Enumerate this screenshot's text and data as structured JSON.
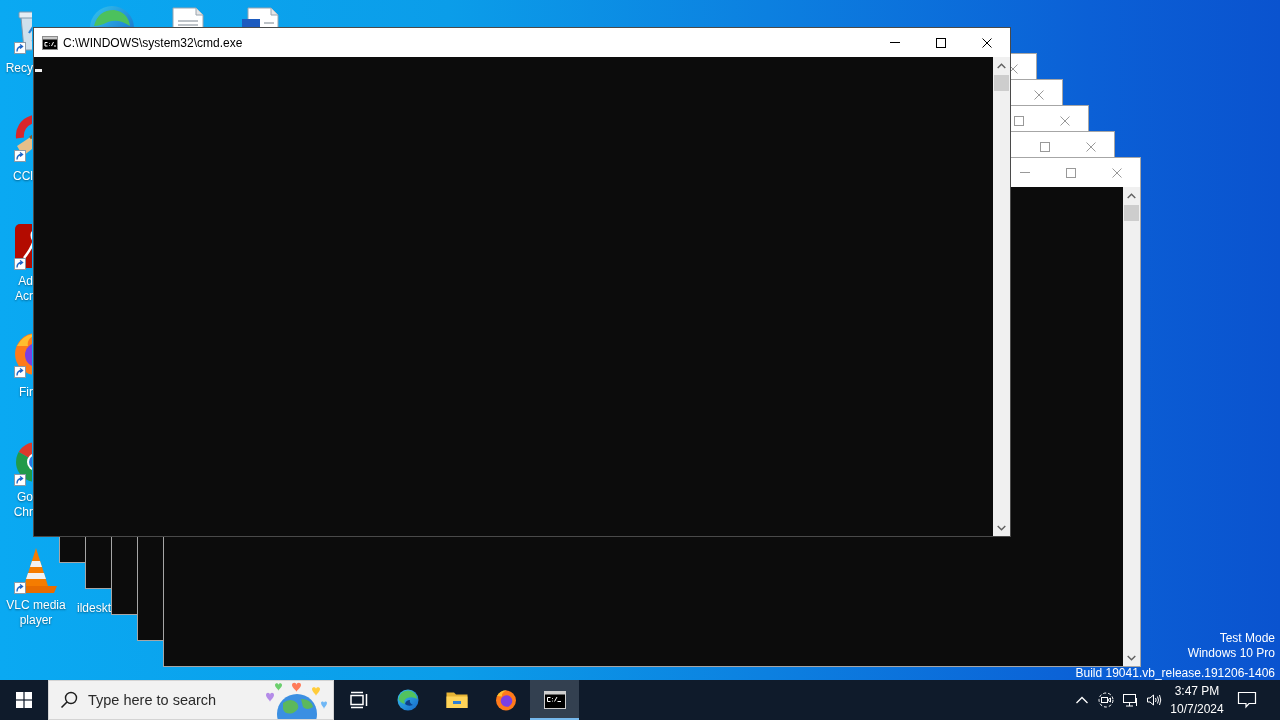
{
  "desktop": {
    "icons": [
      {
        "kind": "bin",
        "label": "Recy"
      },
      {
        "kind": "cleaner",
        "label": "CCl"
      },
      {
        "kind": "pdf",
        "label": "Ad Acr"
      },
      {
        "kind": "firefox",
        "label": "Fir"
      },
      {
        "kind": "chrome",
        "label": "Go Chr"
      },
      {
        "kind": "vlc",
        "label": "VLC media player"
      }
    ],
    "second_column": [
      {
        "label": "ildeskt"
      }
    ],
    "edition_notice": [
      "Test Mode",
      "Windows 10 Pro",
      "Build 19041.vb_release.191206-1406"
    ]
  },
  "windows": [
    {
      "title": "C:\\WINDOWS\\system32\\cmd.exe",
      "focused": true
    },
    {
      "focused": false
    },
    {
      "focused": false
    },
    {
      "focused": false
    },
    {
      "focused": false
    },
    {
      "focused": false
    }
  ],
  "taskbar": {
    "search": {
      "placeholder": "Type here to search"
    },
    "apps": [
      {
        "kind": "taskview",
        "active": false
      },
      {
        "kind": "edge",
        "active": false
      },
      {
        "kind": "explorer",
        "active": false
      },
      {
        "kind": "firefox",
        "active": false
      },
      {
        "kind": "console",
        "active": true
      }
    ],
    "clock": {
      "time": "3:47 PM",
      "date": "10/7/2024"
    }
  }
}
